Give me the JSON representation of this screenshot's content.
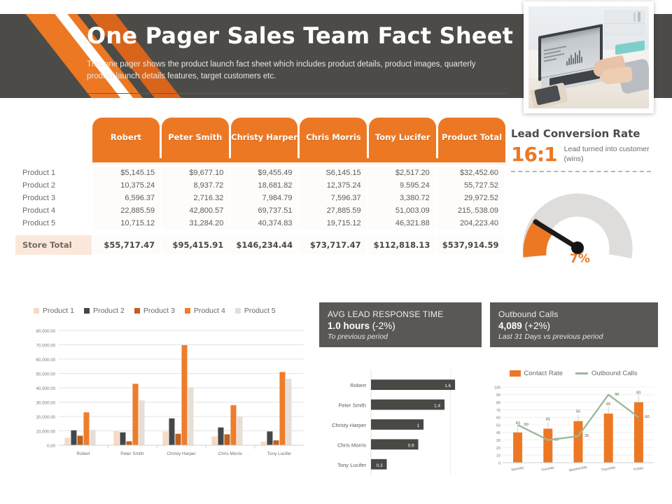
{
  "header": {
    "title": "One Pager Sales Team Fact Sheet",
    "subtitle": "This one pager shows the product launch fact sheet which includes product details, product images, quarterly product launch details features, target customers etc.",
    "photo_alt": "person typing on laptop at desk"
  },
  "colors": {
    "brand_orange": "#ec7824",
    "dark_header": "#4d4b48",
    "kpi_gray": "#5a5855",
    "total_row": "#fae2d2",
    "product1": "#f7d9c4",
    "product2": "#44474a",
    "product3": "#c0601f",
    "product4": "#ee7d2b",
    "product5": "#e7ded6",
    "line_green": "#9db89b"
  },
  "table": {
    "row_header_label": "",
    "columns": [
      "Robert",
      "Peter Smith",
      "Christy Harper",
      "Chris Morris",
      "Tony Lucifer",
      "Product Total"
    ],
    "rows": [
      {
        "label": "Product 1",
        "values": [
          "$5,145.15",
          "$9,677.10",
          "$9,455.49",
          "S6,145.15",
          "$2,517.20",
          "$32,452.60"
        ]
      },
      {
        "label": "Product 2",
        "values": [
          "10,375.24",
          "8,937.72",
          "18,681.82",
          "12,375.24",
          "9.595.24",
          "55,727.52"
        ]
      },
      {
        "label": "Product 3",
        "values": [
          "6,596.37",
          "2,716.32",
          "7,984.79",
          "7,596.37",
          "3,380.72",
          "29,972.52"
        ]
      },
      {
        "label": "Product 4",
        "values": [
          "22,885.59",
          "42,800.57",
          "69,737.51",
          "27,885.59",
          "51,003.09",
          "215,.538.09"
        ]
      },
      {
        "label": "Product 5",
        "values": [
          "10,715.12",
          "31,284.20",
          "40,374.83",
          "19,715.12",
          "46,321.88",
          "204,223.40"
        ]
      }
    ],
    "total": {
      "label": "Store Total",
      "values": [
        "$55,717.47",
        "$95,415.91",
        "$146,234.44",
        "$73,717.47",
        "$112,818.13",
        "$537,914.59"
      ]
    }
  },
  "gauge": {
    "title": "Lead Conversion Rate",
    "ratio": "16:1",
    "caption": "Lead turned into customer (wins)",
    "percent_label": "7%",
    "percent_value": 7
  },
  "kpis": [
    {
      "title": "AVG LEAD RESPONSE TIME",
      "value": "1.0 hours",
      "delta": "(-2%)",
      "note": "To previous period"
    },
    {
      "title": "Outbound Calls",
      "value": "4,089",
      "delta": "(+2%)",
      "note": "Last 31 Days vs previous period"
    }
  ],
  "chart_data": [
    {
      "type": "bar",
      "title": "",
      "xlabel": "",
      "ylabel": "",
      "ylim": [
        0,
        80000
      ],
      "yticks": [
        "0.00",
        "10,000.00",
        "20,000.00",
        "30,000.00",
        "40,000.00",
        "50,000.00",
        "60,000.00",
        "70,000.00",
        "80,000.00"
      ],
      "grid": true,
      "legend_position": "top",
      "categories": [
        "Robert",
        "Peter Smith",
        "Christy Harper",
        "Chris Morris",
        "Tony Lucifer"
      ],
      "series": [
        {
          "name": "Product 1",
          "color": "#f7d9c4",
          "values": [
            5145.15,
            9677.1,
            9455.49,
            6145.15,
            2517.2
          ]
        },
        {
          "name": "Product 2",
          "color": "#44474a",
          "values": [
            10375.24,
            8937.72,
            18681.82,
            12375.24,
            9595.24
          ]
        },
        {
          "name": "Product 3",
          "color": "#c0601f",
          "values": [
            6596.37,
            2716.32,
            7984.79,
            7596.37,
            3380.72
          ]
        },
        {
          "name": "Product 4",
          "color": "#ee7d2b",
          "values": [
            22885.59,
            42800.57,
            69737.51,
            27885.59,
            51003.09
          ]
        },
        {
          "name": "Product 5",
          "color": "#e7ded6",
          "values": [
            10715.12,
            31284.2,
            40374.83,
            19715.12,
            46321.88
          ]
        }
      ]
    },
    {
      "type": "bar",
      "orientation": "horizontal",
      "title": "",
      "grid": true,
      "categories": [
        "Robert",
        "Peter Smith",
        "Christy Harper",
        "Chris Morris",
        "Tony Lucifer"
      ],
      "values": [
        1.6,
        1.4,
        1,
        0.9,
        0.3
      ],
      "value_labels": [
        "1.6",
        "1.4",
        "1",
        "0.9",
        "0.3"
      ],
      "bar_color": "#4a4845",
      "xlim": [
        0,
        2
      ]
    },
    {
      "type": "line",
      "title": "",
      "ylim": [
        0,
        100
      ],
      "yticks": [
        0,
        10,
        20,
        30,
        40,
        50,
        60,
        70,
        80,
        90,
        100
      ],
      "grid": true,
      "legend_position": "top",
      "categories": [
        "Monday",
        "Tuesday",
        "Wednesday",
        "Thursday",
        "Friday"
      ],
      "series": [
        {
          "name": "Contact Rate",
          "type": "bar",
          "color": "#ec7824",
          "values": [
            40,
            45,
            55,
            65,
            80
          ],
          "labels": [
            "40",
            "45",
            "55",
            "65",
            "80"
          ]
        },
        {
          "name": "Outbound Calls",
          "type": "line",
          "color": "#9db89b",
          "values": [
            50,
            30,
            35,
            90,
            60
          ],
          "labels": [
            "50",
            "30",
            "35",
            "90",
            "60"
          ]
        }
      ]
    }
  ]
}
